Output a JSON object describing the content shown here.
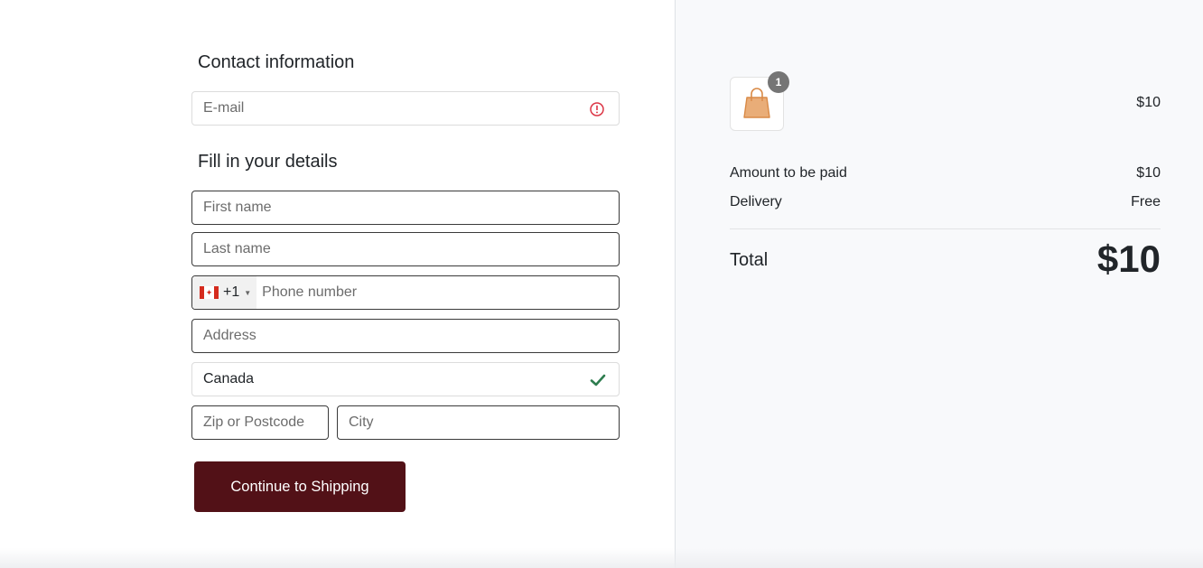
{
  "contact": {
    "heading": "Contact information",
    "email_placeholder": "E-mail",
    "email_status_icon": "alert-circle-icon",
    "email_status_color": "#dc3545"
  },
  "details": {
    "heading": "Fill in your details",
    "first_name_placeholder": "First name",
    "last_name_placeholder": "Last name",
    "phone": {
      "country_flag": "canada-flag-icon",
      "country_code": "+1",
      "placeholder": "Phone number"
    },
    "address_placeholder": "Address",
    "country_value": "Canada",
    "country_status_icon": "checkmark-icon",
    "country_status_color": "#2e7d4f",
    "zip_placeholder": "Zip or Postcode",
    "city_placeholder": "City"
  },
  "actions": {
    "continue_label": "Continue to Shipping",
    "continue_color": "#521117"
  },
  "summary": {
    "cart_icon": "shopping-bag-icon",
    "item_count": "1",
    "item_price": "$10",
    "amount_label": "Amount to be paid",
    "amount_value": "$10",
    "delivery_label": "Delivery",
    "delivery_value": "Free",
    "total_label": "Total",
    "total_value": "$10"
  }
}
